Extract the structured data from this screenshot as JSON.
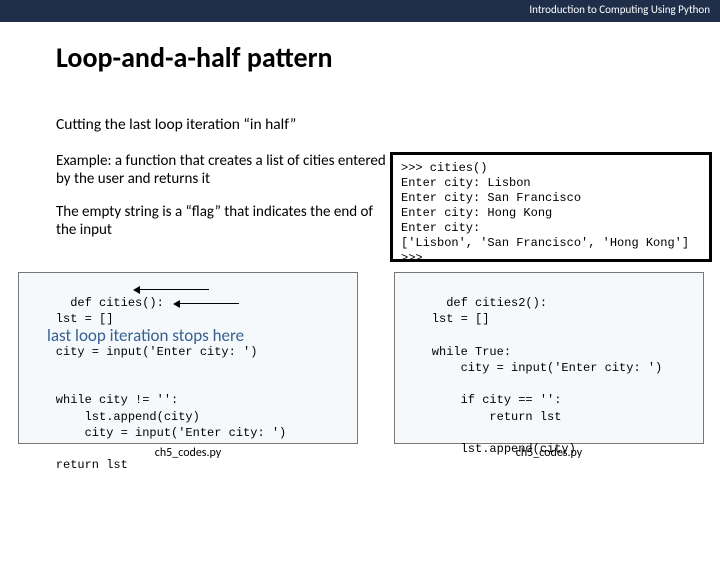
{
  "header": "Introduction to Computing Using Python",
  "title": "Loop-and-a-half pattern",
  "subtitle": "Cutting the last loop iteration “in half”",
  "desc1": "Example: a function that creates a list of cities entered by the user and returns it",
  "desc2": "The empty string is a “flag” that indicates the end of the input",
  "console": ">>> cities()\nEnter city: Lisbon\nEnter city: San Francisco\nEnter city: Hong Kong\nEnter city: \n['Lisbon', 'San Francisco', 'Hong Kong']\n>>>",
  "codeLeft": "def cities():\n    lst = []\n\n    city = input('Enter city: ')\n\n\n    while city != '':\n        lst.append(city)\n        city = input('Enter city: ')\n\n    return lst",
  "overlayNote": "last loop iteration stops here",
  "codeRight": "def cities2():\n    lst = []\n\n    while True:\n        city = input('Enter city: ')\n\n        if city == '':\n            return lst\n\n        lst.append(city)",
  "filenameLeft": "ch5_codes.py",
  "filenameRight": "ch5_codes.py"
}
